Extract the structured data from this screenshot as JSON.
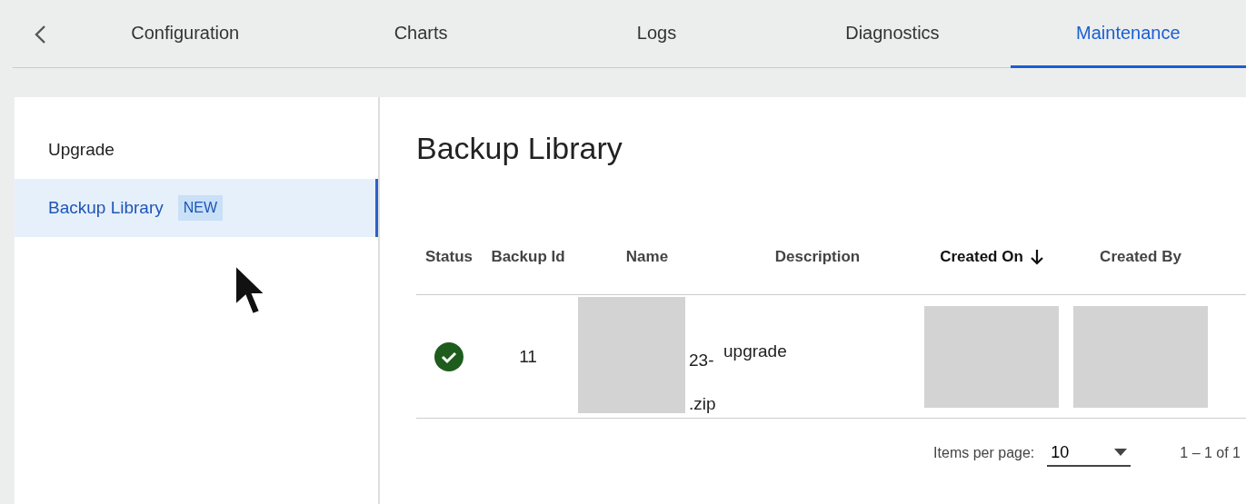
{
  "tabs": [
    {
      "label": "Configuration",
      "selected": false
    },
    {
      "label": "Charts",
      "selected": false
    },
    {
      "label": "Logs",
      "selected": false
    },
    {
      "label": "Diagnostics",
      "selected": false
    },
    {
      "label": "Maintenance",
      "selected": true
    }
  ],
  "sidebar": {
    "items": [
      {
        "label": "Upgrade",
        "selected": false
      },
      {
        "label": "Backup Library",
        "selected": true,
        "badge": "NEW"
      }
    ]
  },
  "content": {
    "title": "Backup Library",
    "table": {
      "columns": [
        {
          "label": "Status",
          "sorted": false
        },
        {
          "label": "Backup Id",
          "sorted": false
        },
        {
          "label": "Name",
          "sorted": false
        },
        {
          "label": "Description",
          "sorted": false
        },
        {
          "label": "Created On",
          "sorted": true
        },
        {
          "label": "Created By",
          "sorted": false
        }
      ],
      "rows": [
        {
          "success": true,
          "backup_id": "11",
          "name": {
            "redacted": true,
            "line_1": "23-",
            "line_2": ".zip"
          },
          "description": "upgrade",
          "created_on": {
            "redacted": true
          },
          "created_by": {
            "redacted": true
          }
        }
      ]
    },
    "paginator": {
      "label": "Items per page:",
      "page_size": "10",
      "range": "1 – 1 of 1"
    }
  }
}
